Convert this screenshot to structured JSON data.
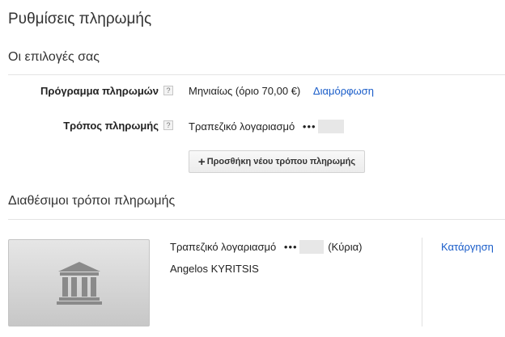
{
  "page": {
    "title": "Ρυθμίσεις πληρωμής"
  },
  "options": {
    "title": "Οι επιλογές σας",
    "schedule": {
      "label": "Πρόγραμμα πληρωμών",
      "help": "?",
      "value": "Μηνιαίως (όριο 70,00 €)",
      "link": "Διαμόρφωση"
    },
    "method": {
      "label": "Τρόπος πληρωμής",
      "help": "?",
      "value": "Τραπεζικό λογαριασμό",
      "dots": "•••"
    },
    "add_button": {
      "icon": "plus-icon",
      "label": "Προσθήκη νέου τρόπου πληρωμής"
    }
  },
  "available": {
    "title": "Διαθέσιμοι τρόποι πληρωμής",
    "methods": [
      {
        "icon": "bank-icon",
        "name": "Τραπεζικό λογαριασμό",
        "dots": "•••",
        "tag": "(Κύρια)",
        "holder": "Angelos KYRITSIS",
        "remove_label": "Κατάργηση"
      }
    ]
  },
  "colors": {
    "link": "#1a5dc9",
    "card_top": "#e6e6e6",
    "card_bottom": "#c7c7c7",
    "icon": "#8a8a8a"
  }
}
